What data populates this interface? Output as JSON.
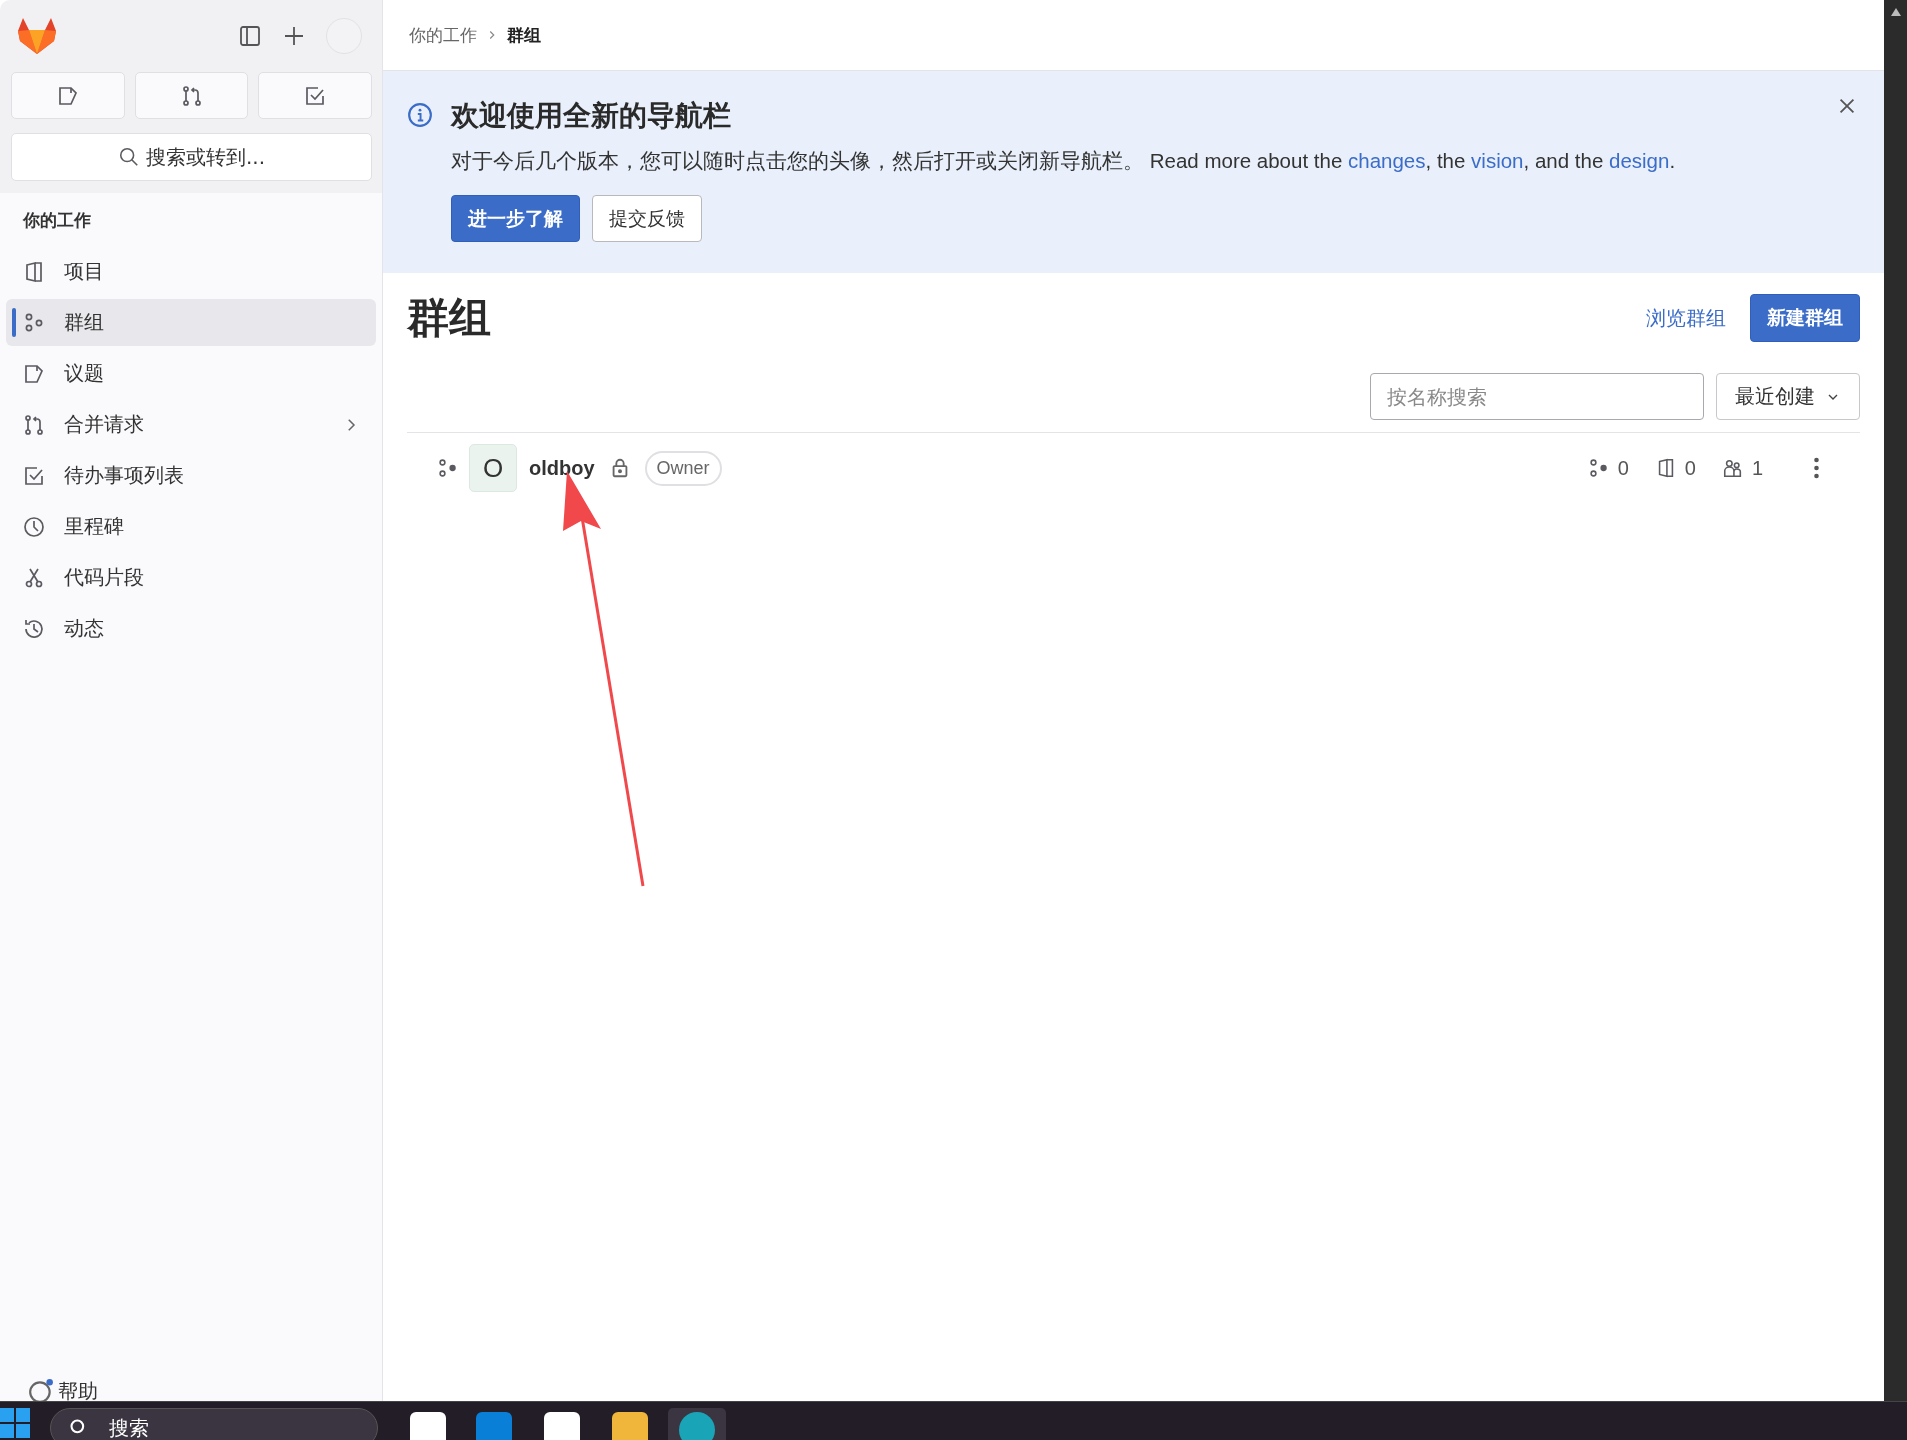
{
  "sidebar": {
    "search_button": "搜索或转到...",
    "section_title": "你的工作",
    "items": [
      {
        "label": "项目",
        "selected": false,
        "has_submenu": false
      },
      {
        "label": "群组",
        "selected": true,
        "has_submenu": false
      },
      {
        "label": "议题",
        "selected": false,
        "has_submenu": false
      },
      {
        "label": "合并请求",
        "selected": false,
        "has_submenu": true
      },
      {
        "label": "待办事项列表",
        "selected": false,
        "has_submenu": false
      },
      {
        "label": "里程碑",
        "selected": false,
        "has_submenu": false
      },
      {
        "label": "代码片段",
        "selected": false,
        "has_submenu": false
      },
      {
        "label": "动态",
        "selected": false,
        "has_submenu": false
      }
    ],
    "help": "帮助"
  },
  "breadcrumb": [
    {
      "label": "你的工作",
      "current": false
    },
    {
      "label": "群组",
      "current": true
    }
  ],
  "banner": {
    "title": "欢迎使用全新的导航栏",
    "text": "对于今后几个版本，您可以随时点击您的头像，然后打开或关闭新导航栏。 Read more about the ",
    "links": [
      {
        "label": "changes",
        "after": ", the "
      },
      {
        "label": "vision",
        "after": ", and the "
      },
      {
        "label": "design",
        "after": "."
      }
    ],
    "buttons": [
      {
        "label": "进一步了解",
        "primary": true
      },
      {
        "label": "提交反馈",
        "primary": false
      }
    ]
  },
  "page": {
    "title": "群组",
    "actions": [
      {
        "label": "浏览群组",
        "kind": "link"
      },
      {
        "label": "新建群组",
        "kind": "primary"
      }
    ],
    "search": {
      "placeholder": "按名称搜索"
    },
    "sort": "最近创建"
  },
  "groups": [
    {
      "avatar": "O",
      "name": "oldboy",
      "private": true,
      "role": "Owner",
      "subgroups": "0",
      "projects": "0",
      "members": "1"
    }
  ],
  "taskbar": {
    "search": "搜索"
  }
}
